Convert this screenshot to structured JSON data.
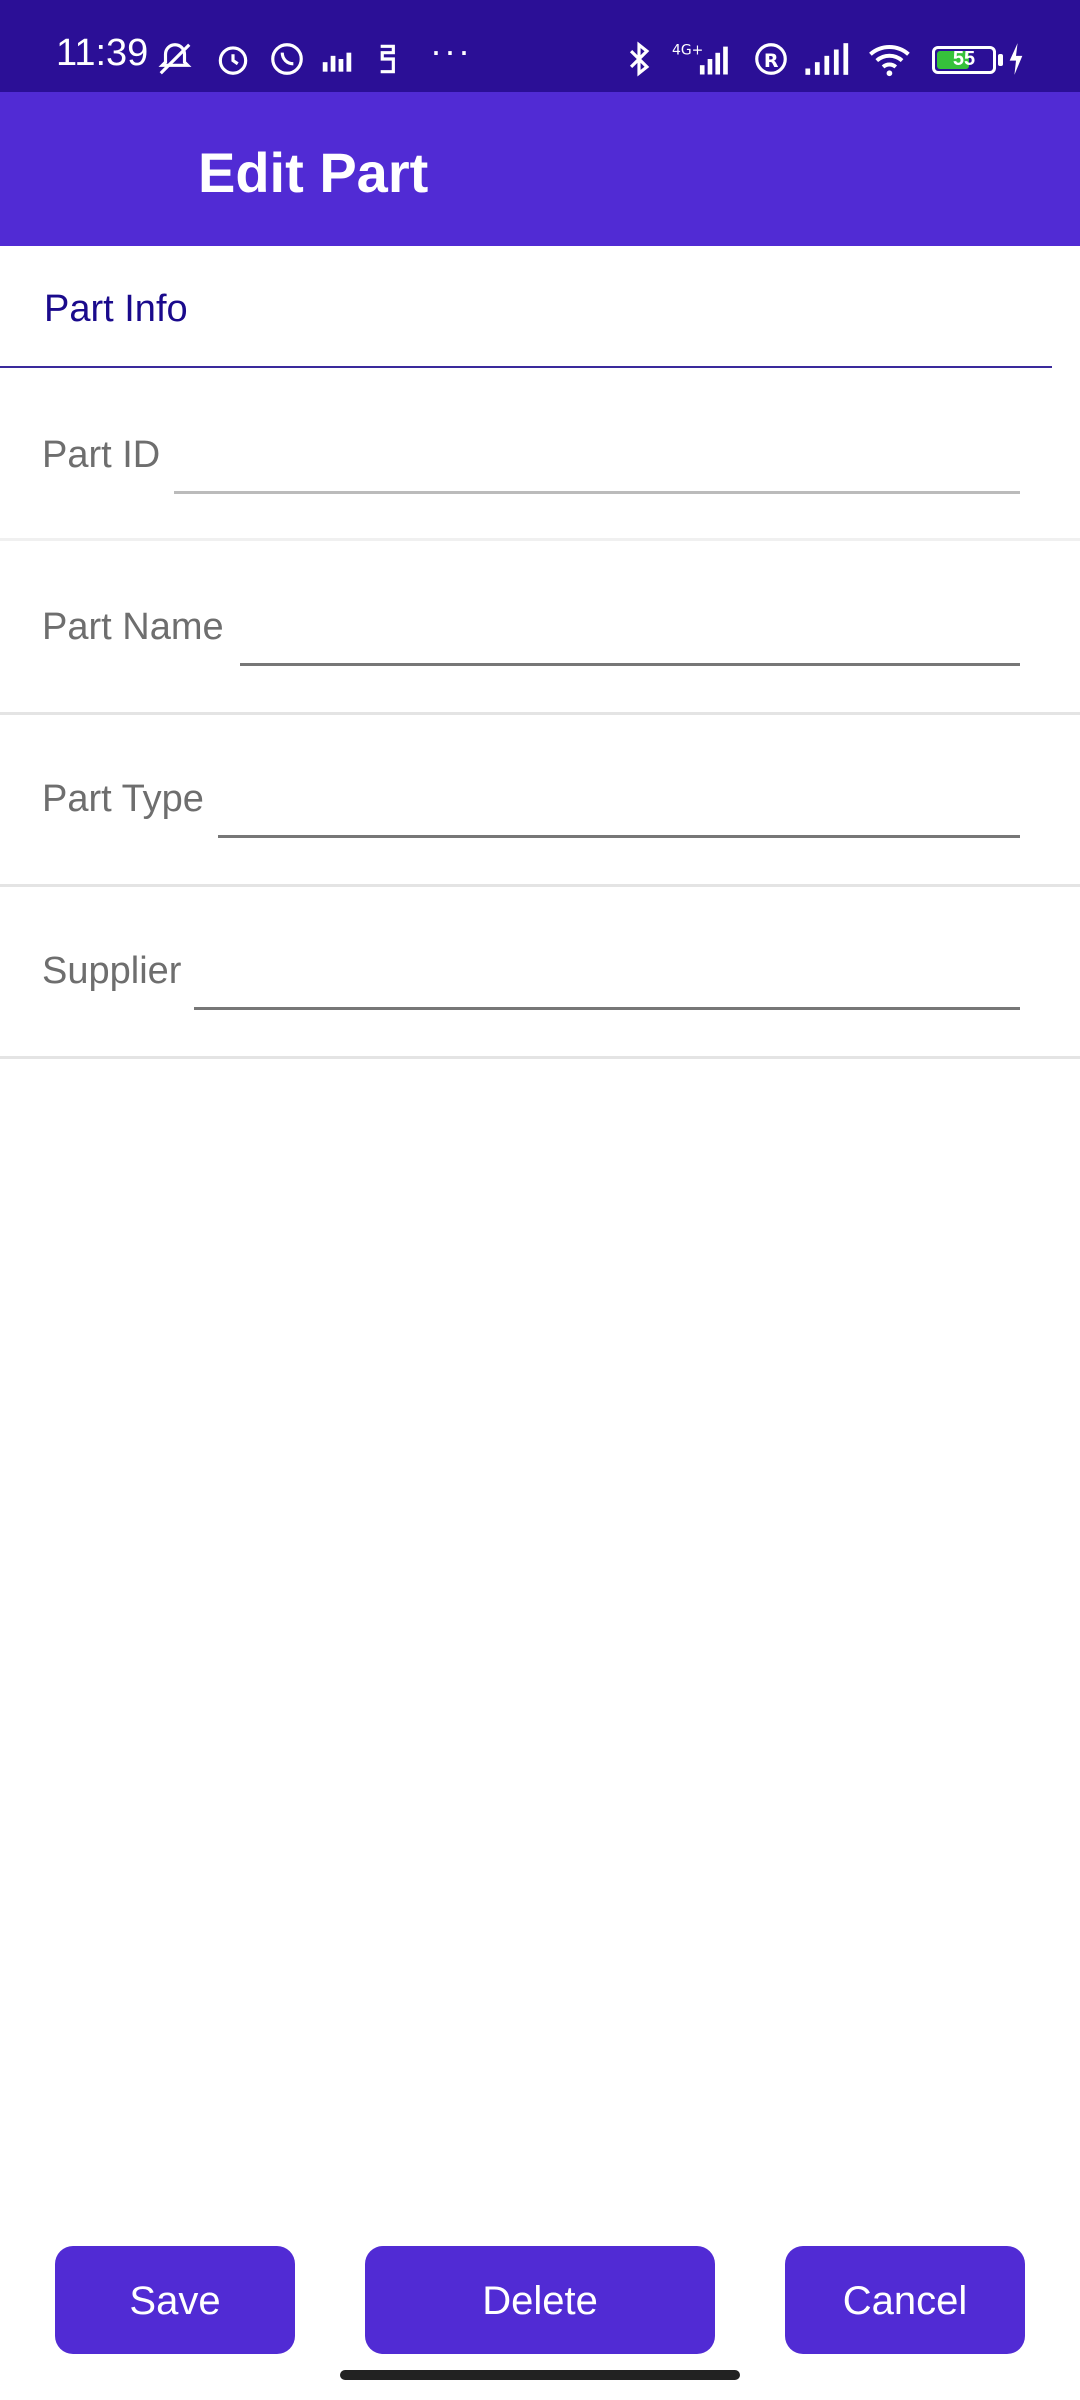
{
  "status_bar": {
    "time": "11:39",
    "battery_level": "55",
    "icons": [
      "bell-off-icon",
      "alarm-icon",
      "whatsapp-icon",
      "equalizer-icon",
      "notification-icon",
      "more-dots-icon",
      "bluetooth-icon",
      "signal-4g-icon",
      "roaming-icon",
      "signal-icon",
      "wifi-icon",
      "battery-icon",
      "charging-icon"
    ],
    "dots": "···"
  },
  "app_bar": {
    "title": "Edit Part"
  },
  "section": {
    "title": "Part Info"
  },
  "fields": [
    {
      "label": "Part ID",
      "value": ""
    },
    {
      "label": "Part Name",
      "value": ""
    },
    {
      "label": "Part Type",
      "value": ""
    },
    {
      "label": "Supplier",
      "value": ""
    }
  ],
  "buttons": {
    "save": "Save",
    "delete": "Delete",
    "cancel": "Cancel"
  },
  "colors": {
    "primary": "#512bd4",
    "status_bar": "#2b0f96",
    "section_text": "#1a0a8c",
    "battery": "#36c13b"
  }
}
